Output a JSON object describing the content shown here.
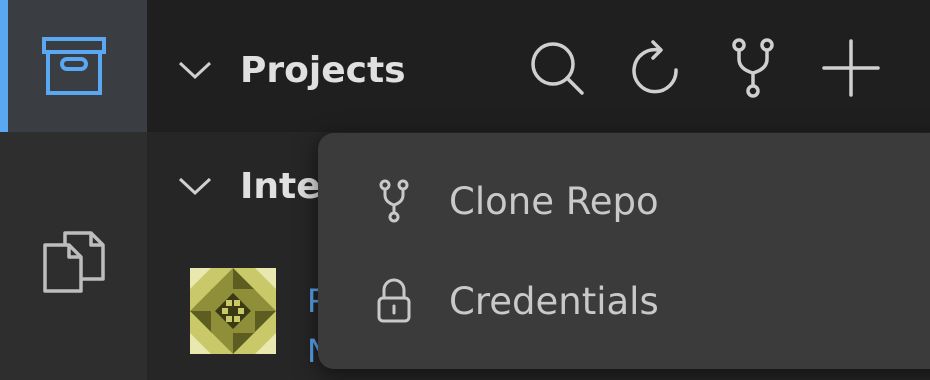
{
  "sidebar": {
    "items": [
      {
        "icon": "archive-box-icon",
        "active": true
      },
      {
        "icon": "files-icon",
        "active": false
      }
    ]
  },
  "header": {
    "title": "Projects",
    "actions": [
      {
        "icon": "search-icon"
      },
      {
        "icon": "refresh-icon"
      },
      {
        "icon": "git-fork-icon"
      },
      {
        "icon": "plus-icon"
      }
    ]
  },
  "section2": {
    "title": "Inte"
  },
  "list": {
    "item_line1": "P",
    "item_line2": "N"
  },
  "menu": {
    "items": [
      {
        "label": "Clone Repo",
        "icon": "git-fork-icon"
      },
      {
        "label": "Credentials",
        "icon": "lock-icon"
      }
    ]
  },
  "colors": {
    "accent": "#5aa7f2",
    "background": "#202020",
    "menu_bg": "#3b3b3b",
    "icon": "#cfcfcf"
  }
}
